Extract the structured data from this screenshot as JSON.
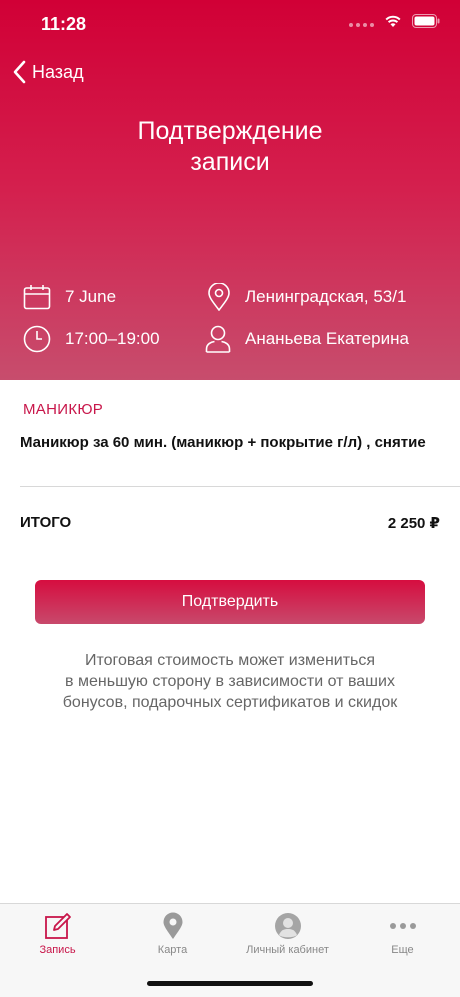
{
  "status_bar": {
    "time": "11:28"
  },
  "nav": {
    "back_label": "Назад"
  },
  "header": {
    "title_line1": "Подтверждение",
    "title_line2": "записи",
    "date": "7 June",
    "time_range": "17:00–19:00",
    "address": "Ленинградская, 53/1",
    "specialist": "Ананьева Екатерина"
  },
  "booking": {
    "category": "МАНИКЮР",
    "service": "Маникюр за 60 мин. (маникюр + покрытие г/л) , снятие",
    "total_label": "ИТОГО",
    "total_value": "2 250 ₽"
  },
  "confirm_label": "Подтвердить",
  "note": {
    "line1": "Итоговая стоимость может измениться",
    "line2": "в меньшую сторону в зависимости от ваших",
    "line3": "бонусов, подарочных сертификатов и скидок"
  },
  "tabbar": {
    "items": [
      {
        "label": "Запись",
        "icon": "edit-icon",
        "active": true
      },
      {
        "label": "Карта",
        "icon": "map-pin-icon",
        "active": false
      },
      {
        "label": "Личный кабинет",
        "icon": "user-avatar-icon",
        "active": false
      },
      {
        "label": "Еще",
        "icon": "more-icon",
        "active": false
      }
    ]
  },
  "colors": {
    "accent": "#d10036",
    "category": "#c8164a",
    "note": "#666666"
  }
}
